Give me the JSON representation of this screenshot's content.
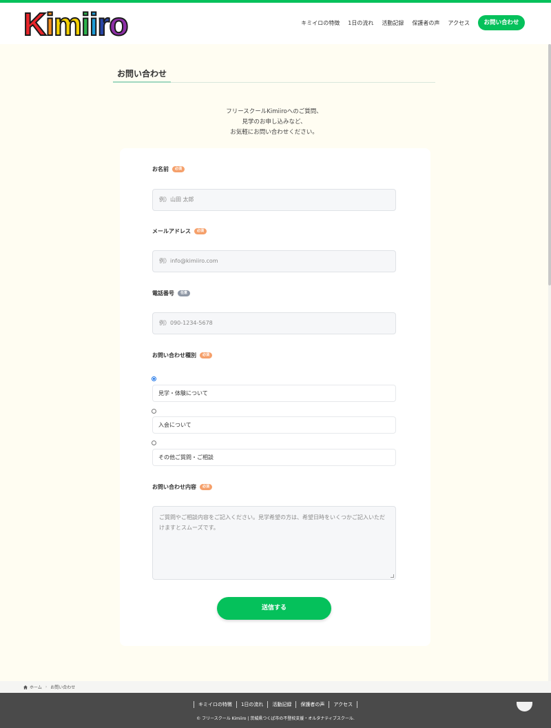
{
  "site": {
    "logo_letters": [
      "K",
      "i",
      "m",
      "i",
      "i",
      "r",
      "o"
    ],
    "logo_colors": [
      "#e8252a",
      "#f08c1b",
      "#f5d000",
      "#2bb24c",
      "#1c9bd6",
      "#2846a6",
      "#8e2fa8"
    ]
  },
  "nav": {
    "items": [
      "キミイロの特徴",
      "1日の流れ",
      "活動記録",
      "保護者の声",
      "アクセス"
    ],
    "cta": "お問い合わせ"
  },
  "page": {
    "title": "お問い合わせ",
    "intro": [
      "フリースクールKimiiroへのご質問、",
      "見学のお申し込みなど、",
      "お気軽にお問い合わせください。"
    ]
  },
  "form": {
    "name": {
      "label": "お名前",
      "badge": "必須",
      "placeholder": "例）山田 太郎"
    },
    "email": {
      "label": "メールアドレス",
      "badge": "必須",
      "placeholder": "例）info@kimiiro.com"
    },
    "phone": {
      "label": "電話番号",
      "badge": "任意",
      "placeholder": "例）090-1234-5678"
    },
    "type": {
      "label": "お問い合わせ種別",
      "badge": "必須",
      "options": [
        "見学・体験について",
        "入会について",
        "その他ご質問・ご相談"
      ],
      "selected_index": 0
    },
    "message": {
      "label": "お問い合わせ内容",
      "badge": "必須",
      "placeholder": "ご質問やご相談内容をご記入ください。見学希望の方は、希望日時をいくつかご記入いただけますとスムーズです。"
    },
    "submit_label": "送信する"
  },
  "breadcrumb": {
    "home": "ホーム",
    "current": "お問い合わせ"
  },
  "footer": {
    "nav": [
      "キミイロの特徴",
      "1日の流れ",
      "活動記録",
      "保護者の声",
      "アクセス"
    ],
    "copyright": "© フリースクール Kimiiro | 茨城県つくば市の不登校支援・オルタナティブスクール."
  },
  "colors": {
    "accent": "#05c15b",
    "required_badge": "#f5a06b",
    "optional_badge": "#8e97a5",
    "footer_bg": "#4a4a4a"
  }
}
